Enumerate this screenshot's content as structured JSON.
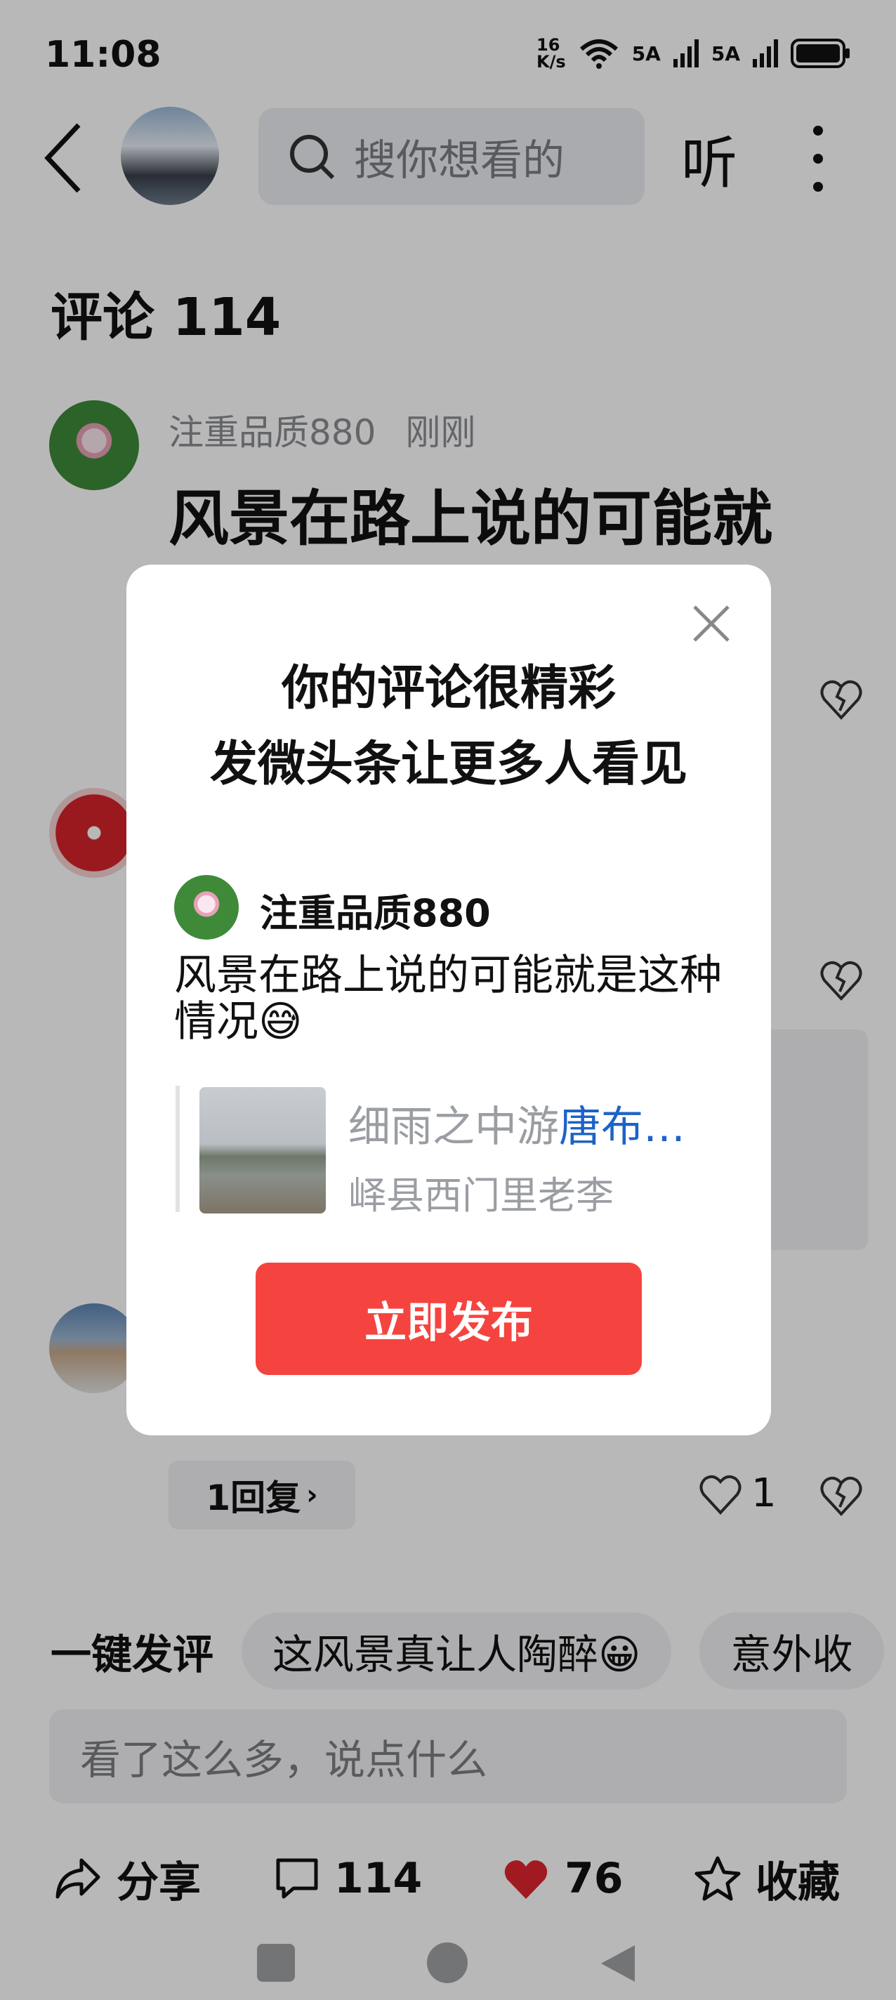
{
  "status_bar": {
    "time": "11:08",
    "net_speed": "16\nK/s",
    "signal1": "5A",
    "signal2": "5A"
  },
  "header": {
    "search_placeholder": "搜你想看的",
    "listen_label": "听"
  },
  "comments": {
    "title": "评论 114",
    "first": {
      "user": "注重品质880",
      "time": "刚刚",
      "text": "风景在路上说的可能就"
    },
    "reply_chip": "1回复",
    "like_count": "1"
  },
  "quick_comments": {
    "label": "一键发评",
    "chips": [
      "这风景真让人陶醉😀",
      "意外收"
    ]
  },
  "comment_input_placeholder": "看了这么多，说点什么",
  "bottom_bar": {
    "share": "分享",
    "comments": "114",
    "likes": "76",
    "favorite": "收藏"
  },
  "modal": {
    "title_line1": "你的评论很精彩",
    "title_line2": "发微头条让更多人看见",
    "user": "注重品质880",
    "text": "风景在路上说的可能就是这种情况😅",
    "quote_title": "细雨之中游",
    "quote_link": "唐布…",
    "quote_sub": "峄县西门里老李",
    "publish_button": "立即发布"
  },
  "colors": {
    "accent": "#f5443f",
    "link": "#1d63c6",
    "heart": "#e0242e"
  }
}
